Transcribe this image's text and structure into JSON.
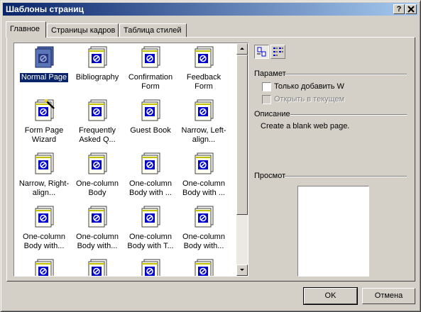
{
  "window": {
    "title": "Шаблоны страниц",
    "help_label": "?",
    "close_label": "✕"
  },
  "tabs": [
    {
      "label": "Главное",
      "active": true
    },
    {
      "label": "Страницы кадров",
      "active": false
    },
    {
      "label": "Таблица стилей",
      "active": false
    }
  ],
  "templates": [
    {
      "label": "Normal Page",
      "icon": "normal-page-icon",
      "selected": true
    },
    {
      "label": "Bibliography",
      "icon": "template-page-icon"
    },
    {
      "label": "Confirmation Form",
      "icon": "template-page-icon"
    },
    {
      "label": "Feedback Form",
      "icon": "template-page-icon"
    },
    {
      "label": "Form Page Wizard",
      "icon": "wizard-page-icon"
    },
    {
      "label": "Frequently Asked Q...",
      "icon": "template-page-icon"
    },
    {
      "label": "Guest Book",
      "icon": "template-page-icon"
    },
    {
      "label": "Narrow, Left-align...",
      "icon": "template-page-icon"
    },
    {
      "label": "Narrow, Right-align...",
      "icon": "template-page-icon"
    },
    {
      "label": "One-column Body",
      "icon": "template-page-icon"
    },
    {
      "label": "One-column Body with ...",
      "icon": "template-page-icon"
    },
    {
      "label": "One-column Body with ...",
      "icon": "template-page-icon"
    },
    {
      "label": "One-column Body with...",
      "icon": "template-page-icon"
    },
    {
      "label": "One-column Body with...",
      "icon": "template-page-icon"
    },
    {
      "label": "One-column Body with T...",
      "icon": "template-page-icon"
    },
    {
      "label": "One-column Body with...",
      "icon": "template-page-icon"
    },
    {
      "label": "",
      "icon": "template-page-icon"
    },
    {
      "label": "",
      "icon": "template-page-icon"
    },
    {
      "label": "",
      "icon": "template-page-icon"
    },
    {
      "label": "",
      "icon": "template-page-icon"
    }
  ],
  "options": {
    "label": "Парамет",
    "checkboxes": [
      {
        "label": "Только добавить W",
        "checked": false,
        "enabled": true
      },
      {
        "label": "Открыть в текущем",
        "checked": false,
        "enabled": false
      }
    ]
  },
  "description": {
    "label": "Описание",
    "text": "Create a blank web page."
  },
  "preview": {
    "label": "Просмот"
  },
  "buttons": {
    "ok": "OK",
    "cancel": "Отмена"
  },
  "colors": {
    "titlebar_start": "#0a246a",
    "titlebar_end": "#a6caf0",
    "face": "#d4d0c8",
    "selection": "#0a246a",
    "icon_blue": "#0000cc"
  }
}
